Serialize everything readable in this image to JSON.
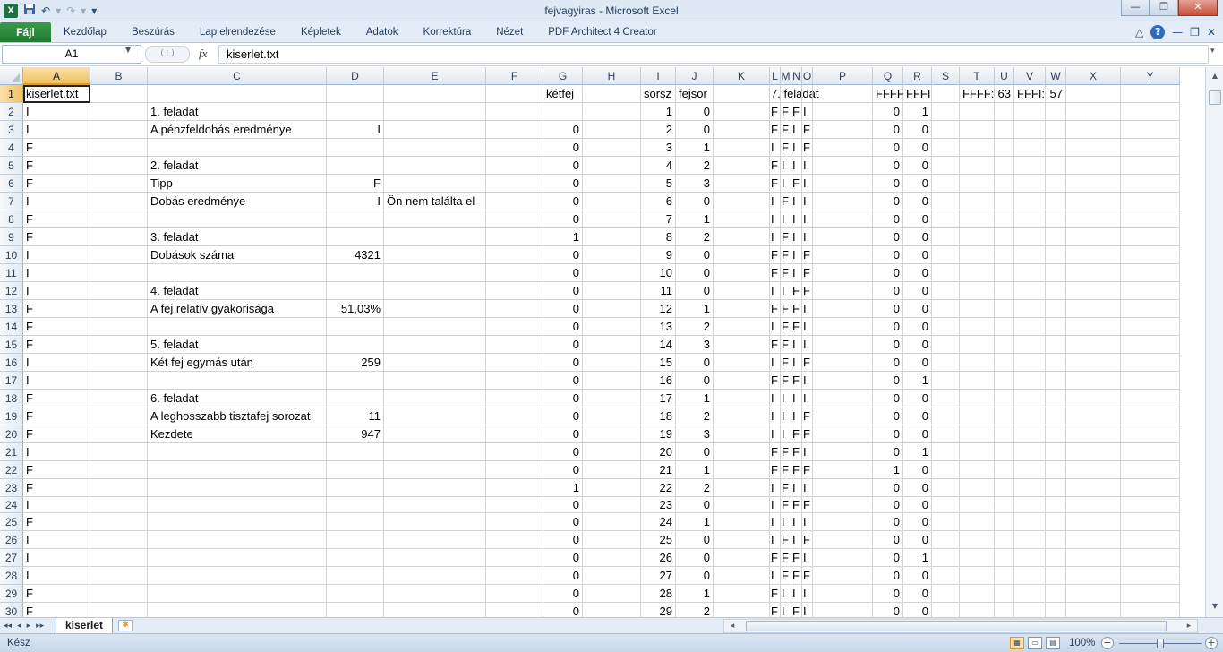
{
  "window": {
    "title": "fejvagyiras  -  Microsoft Excel"
  },
  "qat": {
    "excel_icon": "X",
    "save_icon": "save-icon",
    "undo": "↶",
    "redo": "↷",
    "dropdown": "▾"
  },
  "window_controls": {
    "minimize": "—",
    "restore": "❐",
    "close": "✕"
  },
  "ribbon": {
    "file_tab": "Fájl",
    "tabs": [
      "Kezdőlap",
      "Beszúrás",
      "Lap elrendezése",
      "Képletek",
      "Adatok",
      "Korrektúra",
      "Nézet",
      "PDF Architect 4 Creator"
    ],
    "right_icons": {
      "collapse": "♡",
      "help": "?",
      "min": "—",
      "restore": "❐",
      "close": "✕"
    }
  },
  "formula_bar": {
    "name_box": "A1",
    "fx": "fx",
    "content": "kiserlet.txt",
    "divider": "( ⁝ )"
  },
  "columns": [
    "A",
    "B",
    "C",
    "D",
    "E",
    "F",
    "G",
    "H",
    "I",
    "J",
    "K",
    "L",
    "M",
    "N",
    "O",
    "P",
    "Q",
    "R",
    "S",
    "T",
    "U",
    "V",
    "W",
    "X",
    "Y"
  ],
  "rows": [
    {
      "n": "1",
      "A": "kiserlet.txt",
      "G": "kétfej",
      "I": "sorsz",
      "J": "fejsor",
      "L": "7. feladat",
      "Q": "FFFF",
      "R": "FFFI",
      "T": "FFFF:",
      "U": "63",
      "V": "FFFI:",
      "W": "57"
    },
    {
      "n": "2",
      "A": "I",
      "C": "1. feladat",
      "I": "1",
      "J": "0",
      "L": "F",
      "M": "F",
      "N": "F",
      "O": "I",
      "Q": "0",
      "R": "1"
    },
    {
      "n": "3",
      "A": "I",
      "C": "A pénzfeldobás eredménye",
      "D": "I",
      "G": "0",
      "I": "2",
      "J": "0",
      "L": "F",
      "M": "F",
      "N": "I",
      "O": "F",
      "Q": "0",
      "R": "0"
    },
    {
      "n": "4",
      "A": "F",
      "G": "0",
      "I": "3",
      "J": "1",
      "L": "I",
      "M": "F",
      "N": "I",
      "O": "F",
      "Q": "0",
      "R": "0"
    },
    {
      "n": "5",
      "A": "F",
      "C": "2. feladat",
      "G": "0",
      "I": "4",
      "J": "2",
      "L": "F",
      "M": "I",
      "N": "I",
      "O": "I",
      "Q": "0",
      "R": "0"
    },
    {
      "n": "6",
      "A": "F",
      "C": "Tipp",
      "D": "F",
      "G": "0",
      "I": "5",
      "J": "3",
      "L": "F",
      "M": "I",
      "N": "F",
      "O": "I",
      "Q": "0",
      "R": "0"
    },
    {
      "n": "7",
      "A": "I",
      "C": "Dobás eredménye",
      "D": "I",
      "E": "Ön nem találta el",
      "G": "0",
      "I": "6",
      "J": "0",
      "L": "I",
      "M": "F",
      "N": "I",
      "O": "I",
      "Q": "0",
      "R": "0"
    },
    {
      "n": "8",
      "A": "F",
      "G": "0",
      "I": "7",
      "J": "1",
      "L": "I",
      "M": "I",
      "N": "I",
      "O": "I",
      "Q": "0",
      "R": "0"
    },
    {
      "n": "9",
      "A": "F",
      "C": "3. feladat",
      "G": "1",
      "I": "8",
      "J": "2",
      "L": "I",
      "M": "F",
      "N": "I",
      "O": "I",
      "Q": "0",
      "R": "0"
    },
    {
      "n": "10",
      "A": "I",
      "C": "Dobások száma",
      "D": "4321",
      "G": "0",
      "I": "9",
      "J": "0",
      "L": "F",
      "M": "F",
      "N": "I",
      "O": "F",
      "Q": "0",
      "R": "0"
    },
    {
      "n": "11",
      "A": "I",
      "G": "0",
      "I": "10",
      "J": "0",
      "L": "F",
      "M": "F",
      "N": "I",
      "O": "F",
      "Q": "0",
      "R": "0"
    },
    {
      "n": "12",
      "A": "I",
      "C": "4. feladat",
      "G": "0",
      "I": "11",
      "J": "0",
      "L": "I",
      "M": "I",
      "N": "F",
      "O": "F",
      "Q": "0",
      "R": "0"
    },
    {
      "n": "13",
      "A": "F",
      "C": "A fej relatív gyakorisága",
      "D": "51,03%",
      "G": "0",
      "I": "12",
      "J": "1",
      "L": "F",
      "M": "F",
      "N": "F",
      "O": "I",
      "Q": "0",
      "R": "0"
    },
    {
      "n": "14",
      "A": "F",
      "G": "0",
      "I": "13",
      "J": "2",
      "L": "I",
      "M": "F",
      "N": "F",
      "O": "I",
      "Q": "0",
      "R": "0"
    },
    {
      "n": "15",
      "A": "F",
      "C": "5. feladat",
      "G": "0",
      "I": "14",
      "J": "3",
      "L": "F",
      "M": "F",
      "N": "I",
      "O": "I",
      "Q": "0",
      "R": "0"
    },
    {
      "n": "16",
      "A": "I",
      "C": "Két fej egymás után",
      "D": "259",
      "G": "0",
      "I": "15",
      "J": "0",
      "L": "I",
      "M": "F",
      "N": "I",
      "O": "F",
      "Q": "0",
      "R": "0"
    },
    {
      "n": "17",
      "A": "I",
      "G": "0",
      "I": "16",
      "J": "0",
      "L": "F",
      "M": "F",
      "N": "F",
      "O": "I",
      "Q": "0",
      "R": "1"
    },
    {
      "n": "18",
      "A": "F",
      "C": "6. feladat",
      "G": "0",
      "I": "17",
      "J": "1",
      "L": "I",
      "M": "I",
      "N": "I",
      "O": "I",
      "Q": "0",
      "R": "0"
    },
    {
      "n": "19",
      "A": "F",
      "C": "A leghosszabb tisztafej sorozat",
      "D": "11",
      "G": "0",
      "I": "18",
      "J": "2",
      "L": "I",
      "M": "I",
      "N": "I",
      "O": "F",
      "Q": "0",
      "R": "0"
    },
    {
      "n": "20",
      "A": "F",
      "C": "Kezdete",
      "D": "947",
      "G": "0",
      "I": "19",
      "J": "3",
      "L": "I",
      "M": "I",
      "N": "F",
      "O": "F",
      "Q": "0",
      "R": "0"
    },
    {
      "n": "21",
      "A": "I",
      "G": "0",
      "I": "20",
      "J": "0",
      "L": "F",
      "M": "F",
      "N": "F",
      "O": "I",
      "Q": "0",
      "R": "1"
    },
    {
      "n": "22",
      "A": "F",
      "G": "0",
      "I": "21",
      "J": "1",
      "L": "F",
      "M": "F",
      "N": "F",
      "O": "F",
      "Q": "1",
      "R": "0"
    },
    {
      "n": "23",
      "A": "F",
      "G": "1",
      "I": "22",
      "J": "2",
      "L": "I",
      "M": "F",
      "N": "I",
      "O": "I",
      "Q": "0",
      "R": "0"
    },
    {
      "n": "24",
      "A": "I",
      "G": "0",
      "I": "23",
      "J": "0",
      "L": "I",
      "M": "F",
      "N": "F",
      "O": "F",
      "Q": "0",
      "R": "0"
    },
    {
      "n": "25",
      "A": "F",
      "G": "0",
      "I": "24",
      "J": "1",
      "L": "I",
      "M": "I",
      "N": "I",
      "O": "I",
      "Q": "0",
      "R": "0"
    },
    {
      "n": "26",
      "A": "I",
      "G": "0",
      "I": "25",
      "J": "0",
      "L": "I",
      "M": "F",
      "N": "I",
      "O": "F",
      "Q": "0",
      "R": "0"
    },
    {
      "n": "27",
      "A": "I",
      "G": "0",
      "I": "26",
      "J": "0",
      "L": "F",
      "M": "F",
      "N": "F",
      "O": "I",
      "Q": "0",
      "R": "1"
    },
    {
      "n": "28",
      "A": "I",
      "G": "0",
      "I": "27",
      "J": "0",
      "L": "I",
      "M": "F",
      "N": "F",
      "O": "F",
      "Q": "0",
      "R": "0"
    },
    {
      "n": "29",
      "A": "F",
      "G": "0",
      "I": "28",
      "J": "1",
      "L": "F",
      "M": "I",
      "N": "I",
      "O": "I",
      "Q": "0",
      "R": "0"
    },
    {
      "n": "30",
      "A": "F",
      "G": "0",
      "I": "29",
      "J": "2",
      "L": "F",
      "M": "I",
      "N": "F",
      "O": "I",
      "Q": "0",
      "R": "0"
    }
  ],
  "sheet": {
    "nav": [
      "◂◂",
      "◂",
      "▸",
      "▸▸"
    ],
    "tab": "kiserlet",
    "new_sheet_icon": "new-sheet-icon"
  },
  "status": {
    "text": "Kész",
    "zoom": "100%",
    "zoom_minus": "−",
    "zoom_plus": "+"
  },
  "colors": {
    "selected_header": "#f1c15f",
    "file_tab": "#1f7a32",
    "ribbon": "#e4ecf7",
    "gridline": "#d4d4d4"
  }
}
